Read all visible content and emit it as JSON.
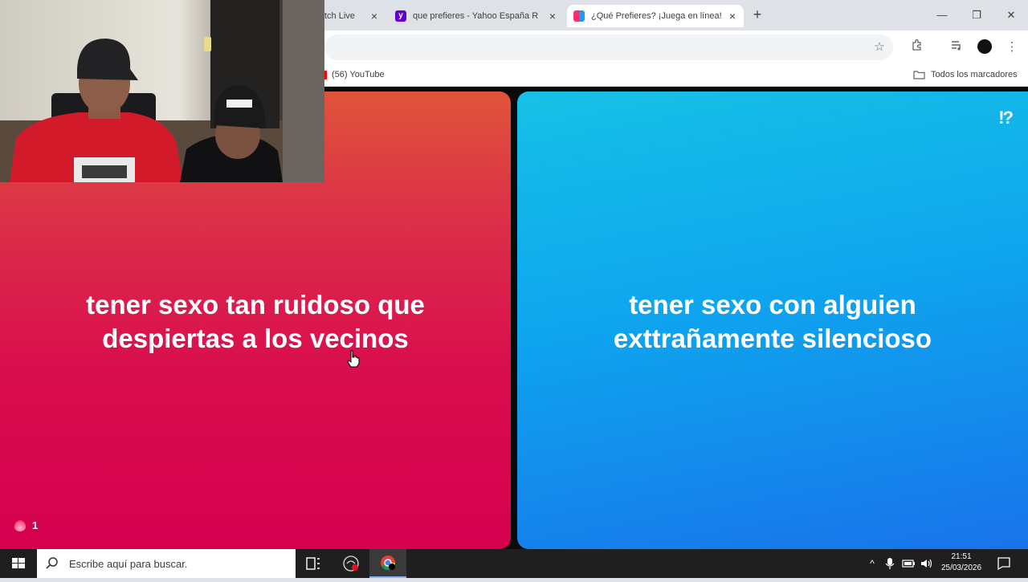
{
  "browser": {
    "tabs": [
      {
        "title": "tch Live",
        "favicon": "twitch-icon",
        "close": "×"
      },
      {
        "title": "que prefieres - Yahoo España R",
        "favicon": "yahoo-icon",
        "close": "×"
      },
      {
        "title": "¿Qué Prefieres? ¡Juega en línea!",
        "favicon": "game-icon",
        "close": "×",
        "active": true
      }
    ],
    "new_tab": "+",
    "window_controls": {
      "minimize": "—",
      "restore": "❐",
      "close": "✕"
    },
    "bookmarks": {
      "youtube": "(56) YouTube",
      "all": "Todos los marcadores"
    }
  },
  "game": {
    "option_a": "tener sexo tan ruidoso que despiertas a los vecinos",
    "option_b": "tener sexo con alguien exttrañamente silencioso",
    "logo": "!?",
    "streak_count": "1",
    "colors": {
      "option_a": "#d90e4e",
      "option_b": "#0ea5ee"
    }
  },
  "taskbar": {
    "search_placeholder": "Escribe aquí para buscar.",
    "time": "21:51",
    "date": "25/03/2026"
  }
}
